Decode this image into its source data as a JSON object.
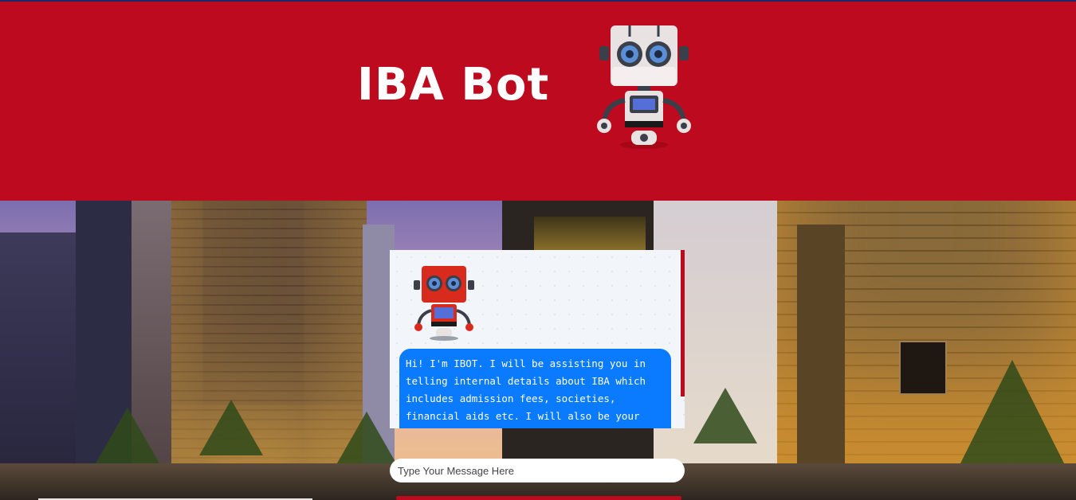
{
  "header": {
    "title": "IBA Bot",
    "background_color": "#be0a1e",
    "logo_icon": "robot-icon"
  },
  "chat": {
    "avatar_icon": "robot-icon",
    "messages": [
      {
        "sender": "bot",
        "text": "Hi! I'm IBOT. I will be assisting you in telling internal details about IBA which includes admission fees, societies, financial aids etc. I will also be your web-scrapper"
      }
    ],
    "bubble_color": "#0a7bff",
    "input_placeholder": "Type Your Message Here"
  }
}
